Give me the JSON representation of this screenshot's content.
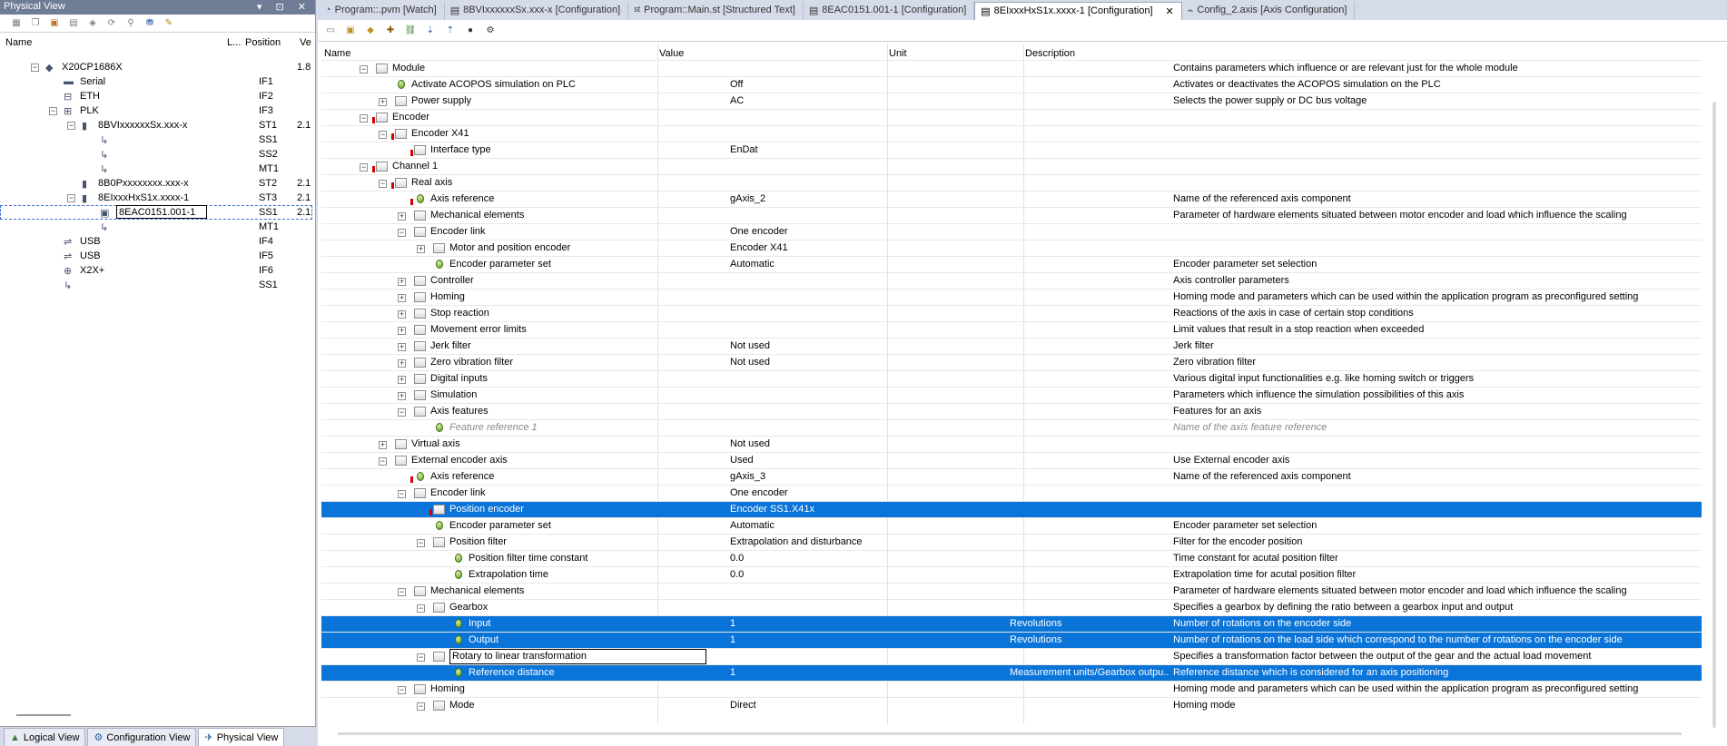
{
  "left_panel": {
    "title": "Physical View",
    "title_buttons": "▾ ⊡ ✕",
    "columns": {
      "name": "Name",
      "l": "L...",
      "position": "Position",
      "version": "Ve"
    },
    "tree": [
      {
        "label": "X20CP1686X",
        "position": "",
        "version": "1.8",
        "indent": 0
      },
      {
        "label": "Serial",
        "position": "IF1",
        "version": "",
        "indent": 1
      },
      {
        "label": "ETH",
        "position": "IF2",
        "version": "",
        "indent": 1
      },
      {
        "label": "PLK",
        "position": "IF3",
        "version": "",
        "indent": 1
      },
      {
        "label": "8BVIxxxxxxSx.xxx-x",
        "position": "ST1",
        "version": "2.1",
        "indent": 2
      },
      {
        "label": "",
        "position": "SS1",
        "version": "",
        "indent": 3
      },
      {
        "label": "",
        "position": "SS2",
        "version": "",
        "indent": 3
      },
      {
        "label": "",
        "position": "MT1",
        "version": "",
        "indent": 3
      },
      {
        "label": "8B0Pxxxxxxxx.xxx-x",
        "position": "ST2",
        "version": "2.1",
        "indent": 2
      },
      {
        "label": "8EIxxxHxS1x.xxxx-1",
        "position": "ST3",
        "version": "2.1",
        "indent": 2
      },
      {
        "label": "8EAC0151.001-1",
        "position": "SS1",
        "version": "2.1",
        "indent": 3
      },
      {
        "label": "",
        "position": "MT1",
        "version": "",
        "indent": 3
      },
      {
        "label": "USB",
        "position": "IF4",
        "version": "",
        "indent": 1
      },
      {
        "label": "USB",
        "position": "IF5",
        "version": "",
        "indent": 1
      },
      {
        "label": "X2X+",
        "position": "IF6",
        "version": "",
        "indent": 1
      },
      {
        "label": "",
        "position": "SS1",
        "version": "",
        "indent": 1
      }
    ],
    "bottom_tabs": [
      {
        "label": "Logical View"
      },
      {
        "label": "Configuration View"
      },
      {
        "label": "Physical View"
      }
    ]
  },
  "editor": {
    "tabs": [
      {
        "label": "Program::.pvm [Watch]"
      },
      {
        "label": "8BVIxxxxxxSx.xxx-x [Configuration]"
      },
      {
        "label": "Program::Main.st [Structured Text]"
      },
      {
        "label": "8EAC0151.001-1 [Configuration]"
      },
      {
        "label": "8EIxxxHxS1x.xxxx-1 [Configuration]",
        "close": "✕"
      },
      {
        "label": "Config_2.axis [Axis Configuration]"
      }
    ],
    "columns": {
      "name": "Name",
      "value": "Value",
      "unit": "Unit",
      "description": "Description"
    },
    "rows": [
      {
        "name": "Module",
        "value": "",
        "unit": "",
        "desc": "Contains parameters which influence or are relevant just for the whole module",
        "level": 1,
        "type": "folder",
        "exp": "-"
      },
      {
        "name": "Activate ACOPOS simulation on PLC",
        "value": "Off",
        "unit": "",
        "desc": "Activates or deactivates the ACOPOS simulation on the PLC",
        "level": 2,
        "type": "param",
        "exp": ""
      },
      {
        "name": "Power supply",
        "value": "AC",
        "unit": "",
        "desc": "Selects the power supply or DC bus voltage",
        "level": 2,
        "type": "folder",
        "exp": "+"
      },
      {
        "name": "Encoder",
        "value": "",
        "unit": "",
        "desc": "",
        "level": 1,
        "type": "folder",
        "exp": "-",
        "err": true
      },
      {
        "name": "Encoder X41",
        "value": "",
        "unit": "",
        "desc": "",
        "level": 2,
        "type": "folder",
        "exp": "-",
        "err": true
      },
      {
        "name": "Interface type",
        "value": "EnDat",
        "unit": "",
        "desc": "",
        "level": 3,
        "type": "folder",
        "exp": "",
        "err": true
      },
      {
        "name": "Channel 1",
        "value": "",
        "unit": "",
        "desc": "",
        "level": 1,
        "type": "folder",
        "exp": "-",
        "err": true
      },
      {
        "name": "Real axis",
        "value": "",
        "unit": "",
        "desc": "",
        "level": 2,
        "type": "folder",
        "exp": "-",
        "err": true
      },
      {
        "name": "Axis reference",
        "value": "gAxis_2",
        "unit": "",
        "desc": "Name of the referenced axis component",
        "level": 3,
        "type": "param",
        "exp": "",
        "err": true
      },
      {
        "name": "Mechanical elements",
        "value": "",
        "unit": "",
        "desc": "Parameter of hardware elements situated between motor encoder and load which influence the scaling",
        "level": 3,
        "type": "folder",
        "exp": "+"
      },
      {
        "name": "Encoder link",
        "value": "One encoder",
        "unit": "",
        "desc": "",
        "level": 3,
        "type": "folder",
        "exp": "-"
      },
      {
        "name": "Motor and position encoder",
        "value": "Encoder X41",
        "unit": "",
        "desc": "",
        "level": 4,
        "type": "folder",
        "exp": "+"
      },
      {
        "name": "Encoder parameter set",
        "value": "Automatic",
        "unit": "",
        "desc": "Encoder parameter set selection",
        "level": 4,
        "type": "param",
        "exp": ""
      },
      {
        "name": "Controller",
        "value": "",
        "unit": "",
        "desc": "Axis controller parameters",
        "level": 3,
        "type": "folder",
        "exp": "+"
      },
      {
        "name": "Homing",
        "value": "",
        "unit": "",
        "desc": "Homing mode and parameters which can be used within the application program as preconfigured setting",
        "level": 3,
        "type": "folder",
        "exp": "+"
      },
      {
        "name": "Stop reaction",
        "value": "",
        "unit": "",
        "desc": "Reactions of the axis in case of certain stop conditions",
        "level": 3,
        "type": "folder",
        "exp": "+"
      },
      {
        "name": "Movement error limits",
        "value": "",
        "unit": "",
        "desc": "Limit values that result in a stop reaction when exceeded",
        "level": 3,
        "type": "folder",
        "exp": "+"
      },
      {
        "name": "Jerk filter",
        "value": "Not used",
        "unit": "",
        "desc": "Jerk filter",
        "level": 3,
        "type": "folder",
        "exp": "+"
      },
      {
        "name": "Zero vibration filter",
        "value": "Not used",
        "unit": "",
        "desc": "Zero vibration filter",
        "level": 3,
        "type": "folder",
        "exp": "+"
      },
      {
        "name": "Digital inputs",
        "value": "",
        "unit": "",
        "desc": "Various digital input functionalities e.g. like homing switch or triggers",
        "level": 3,
        "type": "folder",
        "exp": "+"
      },
      {
        "name": "Simulation",
        "value": "",
        "unit": "",
        "desc": "Parameters which influence the simulation possibilities of this axis",
        "level": 3,
        "type": "folder",
        "exp": "+"
      },
      {
        "name": "Axis features",
        "value": "",
        "unit": "",
        "desc": "Features for an axis",
        "level": 3,
        "type": "folder",
        "exp": "-"
      },
      {
        "name": "Feature reference 1",
        "value": "",
        "unit": "",
        "desc": "Name of the axis feature reference",
        "level": 4,
        "type": "param",
        "exp": "",
        "gray": true
      },
      {
        "name": "Virtual axis",
        "value": "Not used",
        "unit": "",
        "desc": "",
        "level": 2,
        "type": "folder",
        "exp": "+"
      },
      {
        "name": "External encoder axis",
        "value": "Used",
        "unit": "",
        "desc": "Use External encoder axis",
        "level": 2,
        "type": "folder",
        "exp": "-"
      },
      {
        "name": "Axis reference",
        "value": "gAxis_3",
        "unit": "",
        "desc": "Name of the referenced axis component",
        "level": 3,
        "type": "param",
        "exp": "",
        "err": true
      },
      {
        "name": "Encoder link",
        "value": "One encoder",
        "unit": "",
        "desc": "",
        "level": 3,
        "type": "folder",
        "exp": "-"
      },
      {
        "name": "Position encoder",
        "value": "Encoder SS1.X41x",
        "unit": "",
        "desc": "",
        "level": 4,
        "type": "folder",
        "exp": "",
        "err": true,
        "sel": true
      },
      {
        "name": "Encoder parameter set",
        "value": "Automatic",
        "unit": "",
        "desc": "Encoder parameter set selection",
        "level": 4,
        "type": "param",
        "exp": ""
      },
      {
        "name": "Position filter",
        "value": "Extrapolation and disturbance",
        "unit": "",
        "desc": "Filter for the encoder position",
        "level": 4,
        "type": "folder",
        "exp": "-"
      },
      {
        "name": "Position filter time constant",
        "value": "0.0",
        "unit": "",
        "desc": "Time constant for acutal position filter",
        "level": 5,
        "type": "param",
        "exp": ""
      },
      {
        "name": "Extrapolation time",
        "value": "0.0",
        "unit": "",
        "desc": "Extrapolation time for acutal position filter",
        "level": 5,
        "type": "param",
        "exp": ""
      },
      {
        "name": "Mechanical elements",
        "value": "",
        "unit": "",
        "desc": "Parameter of hardware elements situated between motor encoder and load which influence the scaling",
        "level": 3,
        "type": "folder",
        "exp": "-"
      },
      {
        "name": "Gearbox",
        "value": "",
        "unit": "",
        "desc": "Specifies a gearbox by defining the ratio between a gearbox input and output",
        "level": 4,
        "type": "folder",
        "exp": "-"
      },
      {
        "name": "Input",
        "value": "1",
        "unit": "Revolutions",
        "desc": "Number of rotations on the encoder side",
        "level": 5,
        "type": "param",
        "exp": "",
        "sel": true
      },
      {
        "name": "Output",
        "value": "1",
        "unit": "Revolutions",
        "desc": "Number of rotations on the load side which correspond to the number of rotations on the encoder side",
        "level": 5,
        "type": "param",
        "exp": "",
        "sel": true
      },
      {
        "name": "Rotary to linear transformation",
        "value": "",
        "unit": "",
        "desc": "Specifies a transformation factor between the output of the gear and the actual load movement",
        "level": 4,
        "type": "folder",
        "exp": "-",
        "edit": true
      },
      {
        "name": "Reference distance",
        "value": "1",
        "unit": "Measurement units/Gearbox outpu...",
        "desc": "Reference distance which is considered for an axis positioning",
        "level": 5,
        "type": "param",
        "exp": "",
        "sel": true
      },
      {
        "name": "Homing",
        "value": "",
        "unit": "",
        "desc": "Homing mode and parameters which can be used within the application program as preconfigured setting",
        "level": 3,
        "type": "folder",
        "exp": "-"
      },
      {
        "name": "Mode",
        "value": "Direct",
        "unit": "",
        "desc": "Homing mode",
        "level": 4,
        "type": "folder",
        "exp": "-"
      }
    ]
  },
  "colors": {
    "selection": "#0a74d8",
    "panel_title": "#6f7c96",
    "chrome": "#d6dbe9",
    "error_marker": "#d40000"
  }
}
